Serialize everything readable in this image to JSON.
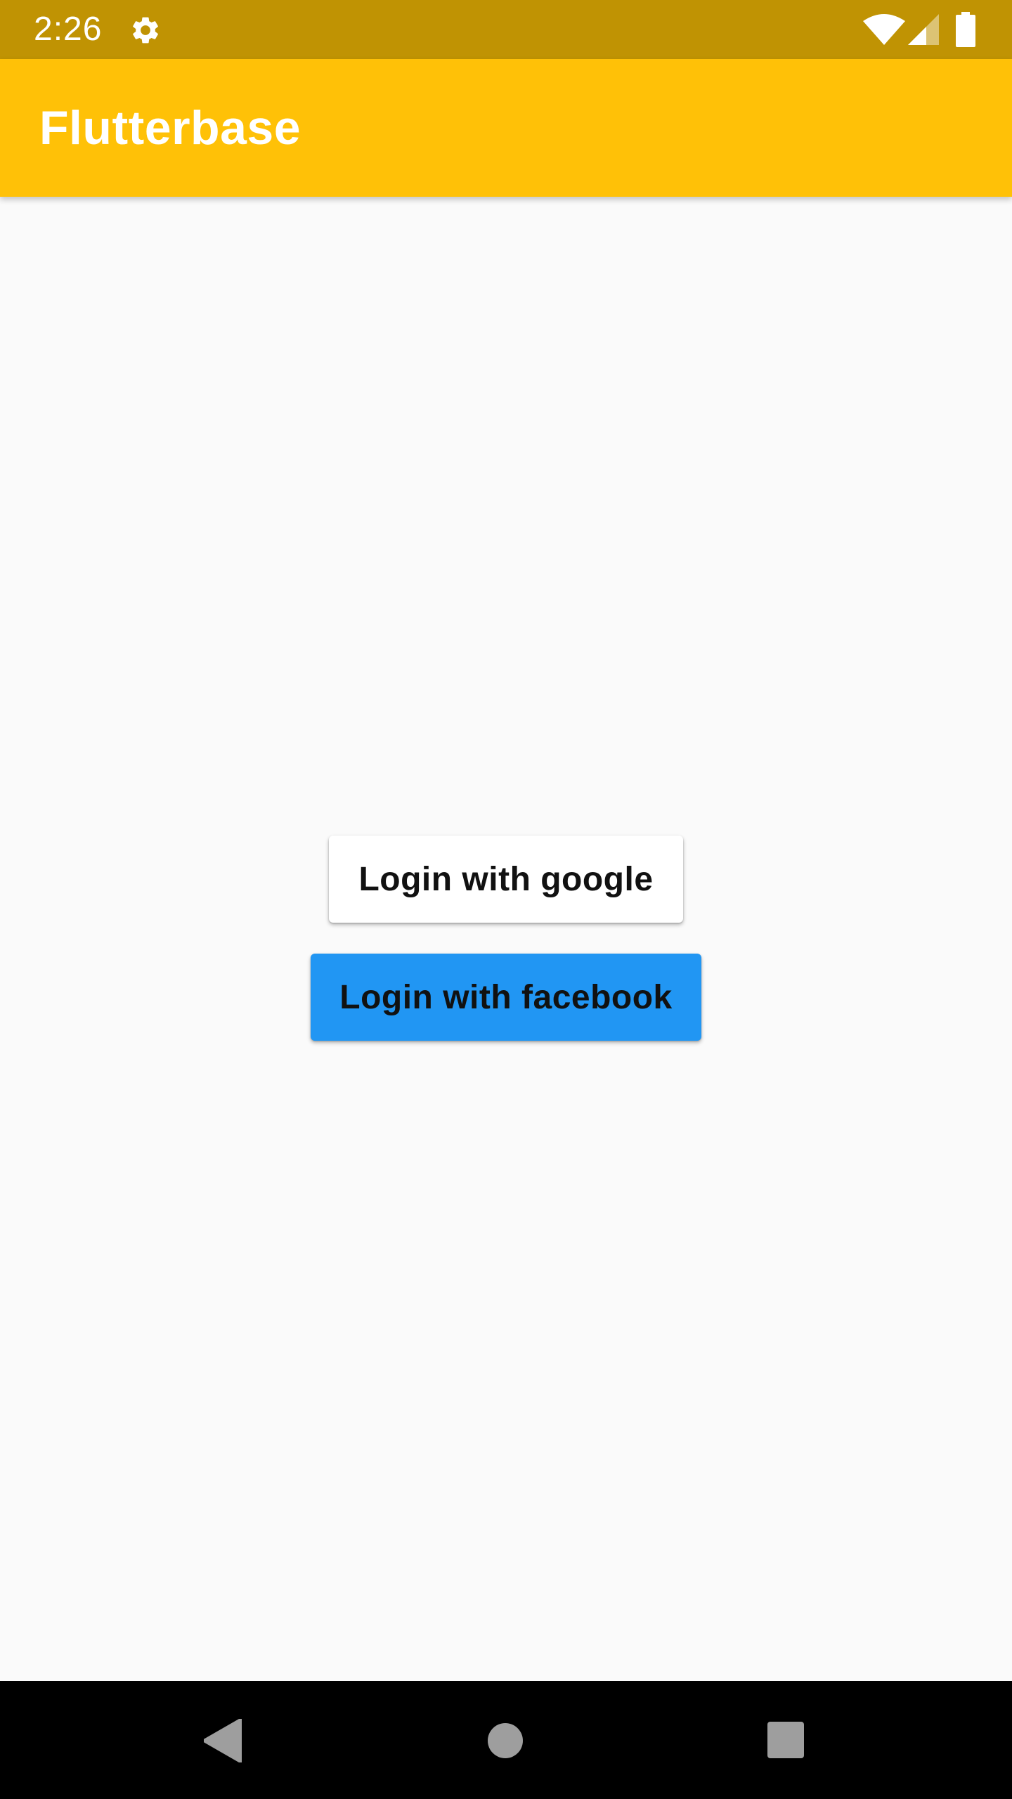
{
  "status_bar": {
    "time": "2:26",
    "background_color": "#c09303",
    "icons": [
      "gear-icon",
      "wifi-icon",
      "cell-signal-icon",
      "battery-icon"
    ]
  },
  "app_bar": {
    "title": "Flutterbase",
    "background_color": "#ffc107"
  },
  "login": {
    "google_label": "Login with google",
    "facebook_label": "Login with facebook",
    "facebook_color": "#2196f3"
  },
  "nav_bar": {
    "icons": [
      "back-icon",
      "home-icon",
      "recents-icon"
    ]
  }
}
